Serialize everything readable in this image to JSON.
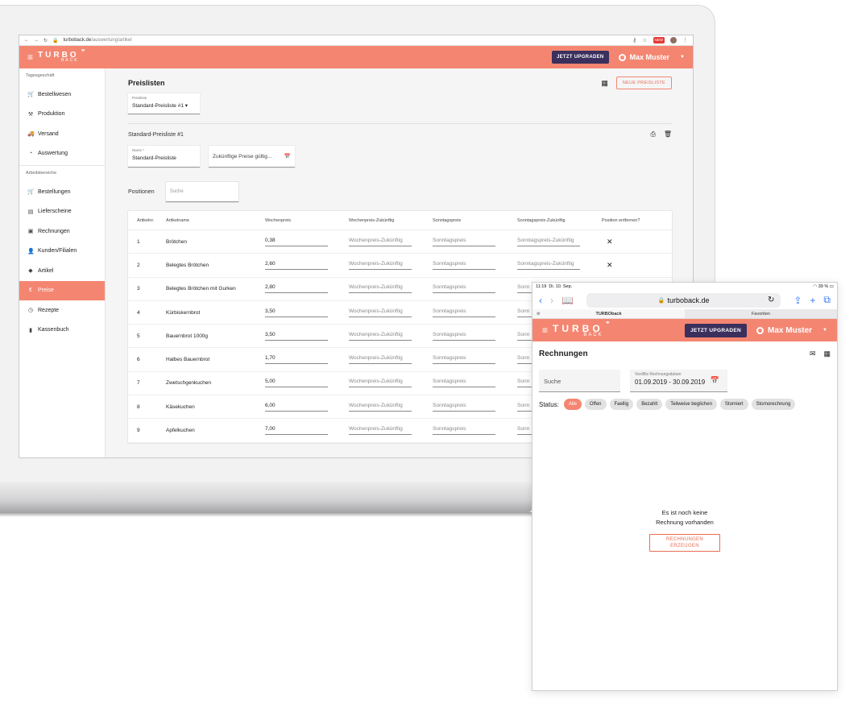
{
  "desktop": {
    "browser": {
      "url_host": "turboback.de",
      "url_path": "/auswertung/artikel",
      "new_badge": "NEW"
    },
    "header": {
      "logo_top": "TURBO",
      "logo_bottom": "BACK",
      "upgrade_label": "JETZT UPGRADEN",
      "user_name": "Max Muster"
    },
    "sidebar": {
      "section1": "Tagesgeschäft",
      "section2": "Arbeitsbereiche",
      "items1": [
        {
          "label": "Bestellwesen",
          "icon": "🛒"
        },
        {
          "label": "Produktion",
          "icon": "⚒"
        },
        {
          "label": "Versand",
          "icon": "🚚"
        },
        {
          "label": "Auswertung",
          "icon": "◔"
        }
      ],
      "items2": [
        {
          "label": "Bestellungen",
          "icon": "🛒"
        },
        {
          "label": "Lieferscheine",
          "icon": "▤"
        },
        {
          "label": "Rechnungen",
          "icon": "▣"
        },
        {
          "label": "Kunden/Filialen",
          "icon": "👤"
        },
        {
          "label": "Artikel",
          "icon": "◆"
        },
        {
          "label": "Preise",
          "icon": "€"
        },
        {
          "label": "Rezepte",
          "icon": "◷"
        },
        {
          "label": "Kassenbuch",
          "icon": "▮"
        }
      ]
    },
    "main": {
      "title": "Preislisten",
      "new_button": "NEUE PREISLISTE",
      "select_label": "Preisliste",
      "select_value": "Standard-Preisliste #1",
      "subtitle": "Standard-Preisliste #1",
      "name_label": "Name *",
      "name_value": "Standard-Preisliste",
      "future_prices": "Zukünftige Preise gültig...",
      "positions_label": "Positionen",
      "search_placeholder": "Suche",
      "columns": [
        "Artikelnr.",
        "Artikelname",
        "Wochenpreis",
        "Wochenpreis-Zukünftig",
        "Sonntagspreis",
        "Sonntagspreis-Zukünftig",
        "Position entfernen?"
      ],
      "rows": [
        {
          "nr": "1",
          "name": "Brötchen",
          "price": "0,38",
          "future": "Wochenpreis-Zukünftig",
          "sunday": "Sonntagspreis",
          "sunday_future": "Sonntagspreis-Zukünftig",
          "remove": "✕"
        },
        {
          "nr": "2",
          "name": "Belegtes Brötchen",
          "price": "2,60",
          "future": "Wochenpreis-Zukünftig",
          "sunday": "Sonntagspreis",
          "sunday_future": "Sonntagspreis-Zukünftig",
          "remove": "✕"
        },
        {
          "nr": "3",
          "name": "Belegtes Brötchen mit Gurken",
          "price": "2,80",
          "future": "Wochenpreis-Zukünftig",
          "sunday": "Sonntagspreis",
          "sunday_future": "Sonn",
          "remove": ""
        },
        {
          "nr": "4",
          "name": "Kürbiskernbrot",
          "price": "3,50",
          "future": "Wochenpreis-Zukünftig",
          "sunday": "Sonntagspreis",
          "sunday_future": "Sonn",
          "remove": ""
        },
        {
          "nr": "5",
          "name": "Bauernbrot 1000g",
          "price": "3,50",
          "future": "Wochenpreis-Zukünftig",
          "sunday": "Sonntagspreis",
          "sunday_future": "Sonn",
          "remove": ""
        },
        {
          "nr": "6",
          "name": "Halbes Bauernbrot",
          "price": "1,70",
          "future": "Wochenpreis-Zukünftig",
          "sunday": "Sonntagspreis",
          "sunday_future": "Sonn",
          "remove": ""
        },
        {
          "nr": "7",
          "name": "Zwetschgenkuchen",
          "price": "5,00",
          "future": "Wochenpreis-Zukünftig",
          "sunday": "Sonntagspreis",
          "sunday_future": "Sonn",
          "remove": ""
        },
        {
          "nr": "8",
          "name": "Käsekuchen",
          "price": "6,00",
          "future": "Wochenpreis-Zukünftig",
          "sunday": "Sonntagspreis",
          "sunday_future": "Sonn",
          "remove": ""
        },
        {
          "nr": "9",
          "name": "Apfelkuchen",
          "price": "7,00",
          "future": "Wochenpreis-Zukünftig",
          "sunday": "Sonntagspreis",
          "sunday_future": "Sonn",
          "remove": ""
        }
      ]
    }
  },
  "tablet": {
    "status": {
      "time": "11:19",
      "date": "Di. 10. Sep.",
      "battery": "39 %"
    },
    "url": "turboback.de",
    "tabs": [
      "TURBOback",
      "Favoriten"
    ],
    "header": {
      "logo_top": "TURBO",
      "logo_bottom": "BACK",
      "upgrade_label": "JETZT UPGRADEN",
      "user_name": "Max Muster"
    },
    "title": "Rechnungen",
    "search_placeholder": "Suche",
    "date_label": "Von/Bis Rechnungsdatum",
    "date_value": "01.09.2019 - 30.09.2019",
    "status_label": "Status:",
    "status_chips": [
      "Alle",
      "Offen",
      "Faellig",
      "Bezahlt",
      "Teilweise beglichen",
      "Storniert",
      "Stornorechnung"
    ],
    "empty_line1": "Es ist noch keine",
    "empty_line2": "Rechnung vorhanden",
    "generate_line1": "RECHNUNGEN",
    "generate_line2": "ERZEUGEN"
  },
  "colors": {
    "accent": "#f48671",
    "upgrade": "#3a2f5d"
  }
}
